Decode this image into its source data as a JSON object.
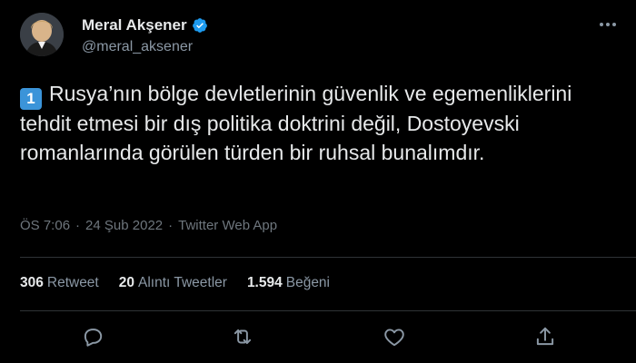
{
  "author": {
    "name": "Meral Akşener",
    "handle": "@meral_aksener",
    "verified": true
  },
  "icons": {
    "avatar": "avatar",
    "verified": "verified-badge-icon",
    "more": "more-options-icon",
    "reply": "reply-icon",
    "retweet": "retweet-icon",
    "like": "like-icon",
    "share": "share-icon"
  },
  "tweet": {
    "keycap": "1",
    "text": "Rusya’nın bölge devletlerinin güvenlik ve egemenliklerini tehdit etmesi bir dış politika doktrini değil, Dostoyevski romanlarında görülen türden bir ruhsal bunalımdır."
  },
  "meta": {
    "time": "ÖS 7:06",
    "separator": "·",
    "date": "24 Şub 2022",
    "source": "Twitter Web App"
  },
  "stats": {
    "retweets": {
      "count": "306",
      "label": "Retweet"
    },
    "quotes": {
      "count": "20",
      "label": "Alıntı Tweetler"
    },
    "likes": {
      "count": "1.594",
      "label": "Beğeni"
    }
  },
  "colors": {
    "background": "#000000",
    "text": "#e7e9ea",
    "secondary": "#8b98a5",
    "verified": "#1d9bf0",
    "keycap": "#3b94d9",
    "divider": "#2f3336"
  }
}
